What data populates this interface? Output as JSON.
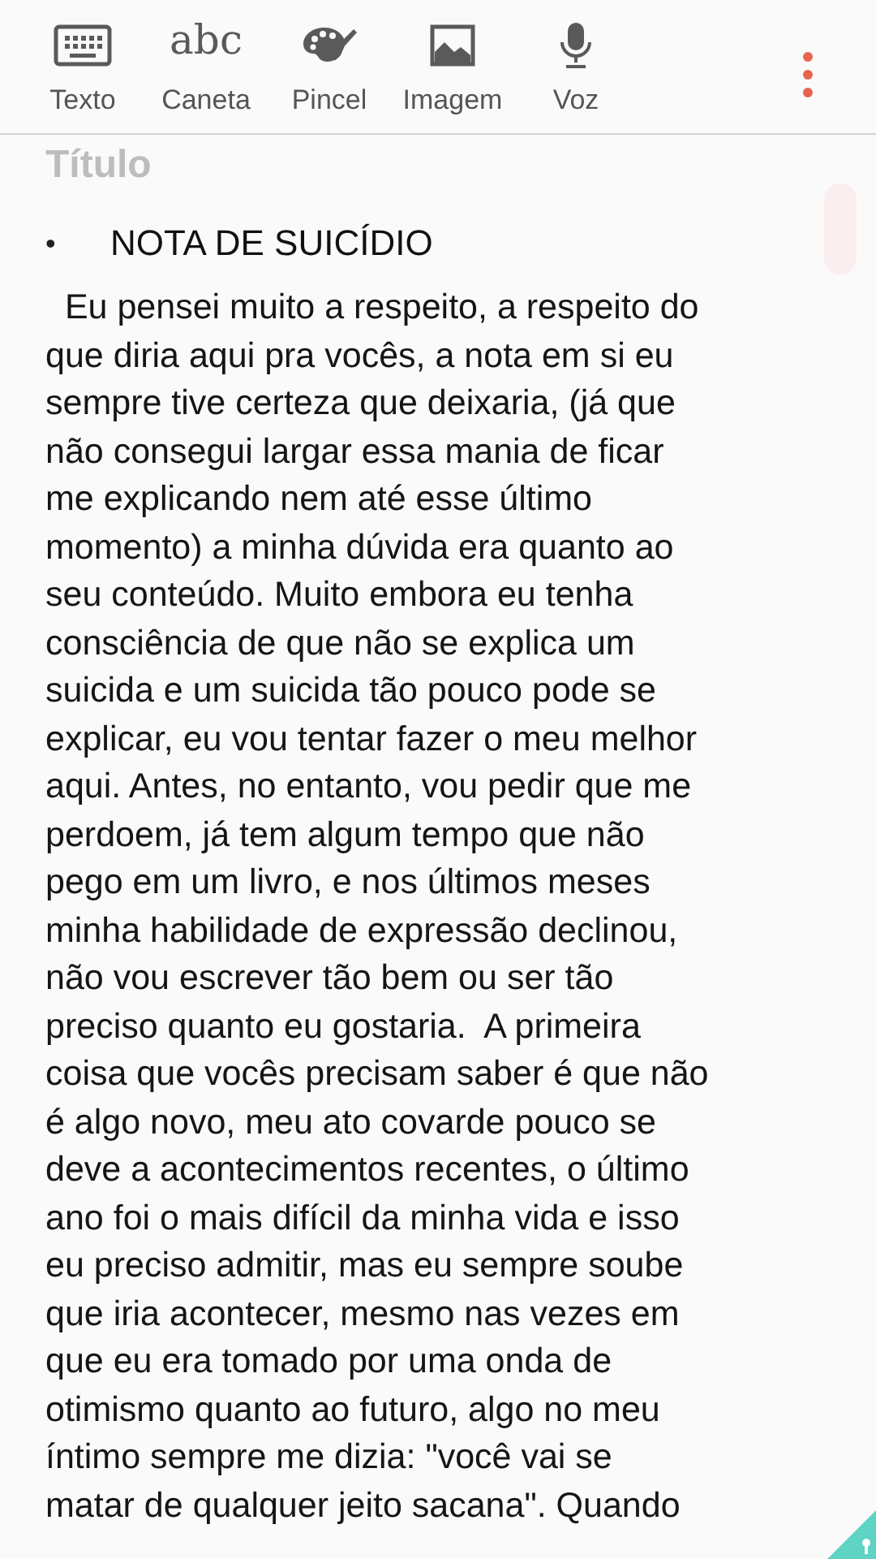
{
  "toolbar": {
    "tools": [
      {
        "kind": "keyboard",
        "label": "Texto"
      },
      {
        "kind": "handwriting",
        "glyph": "abc",
        "label": "Caneta"
      },
      {
        "kind": "palette",
        "label": "Pincel"
      },
      {
        "kind": "image",
        "label": "Imagem"
      },
      {
        "kind": "mic",
        "label": "Voz"
      }
    ]
  },
  "note": {
    "title_placeholder": "Título",
    "bullet": "•",
    "heading": "NOTA DE SUICÍDIO",
    "body_lines": [
      "  Eu pensei muito a respeito, a respeito do",
      "que diria aqui pra vocês, a nota em si eu",
      "sempre tive certeza que deixaria, (já que",
      "não consegui largar essa mania de ficar",
      "me explicando nem até esse último",
      "momento) a minha dúvida era quanto ao",
      "seu conteúdo. Muito embora eu tenha",
      "consciência de que não se explica um",
      "suicida e um suicida tão pouco pode se",
      "explicar, eu vou tentar fazer o meu melhor",
      "aqui. Antes, no entanto, vou pedir que me",
      "perdoem, já tem algum tempo que não",
      "pego em um livro, e nos últimos meses",
      "minha habilidade de expressão declinou,",
      "não vou escrever tão bem ou ser tão",
      "preciso quanto eu gostaria.  A primeira",
      "coisa que vocês precisam saber é que não",
      "é algo novo, meu ato covarde pouco se",
      "deve a acontecimentos recentes, o último",
      "ano foi o mais difícil da minha vida e isso",
      "eu preciso admitir, mas eu sempre soube",
      "que iria acontecer, mesmo nas vezes em",
      "que eu era tomado por uma onda de",
      "otimismo quanto ao futuro, algo no meu",
      "íntimo sempre me dizia: \"você vai se",
      "matar de qualquer jeito sacana\". Quando"
    ]
  }
}
